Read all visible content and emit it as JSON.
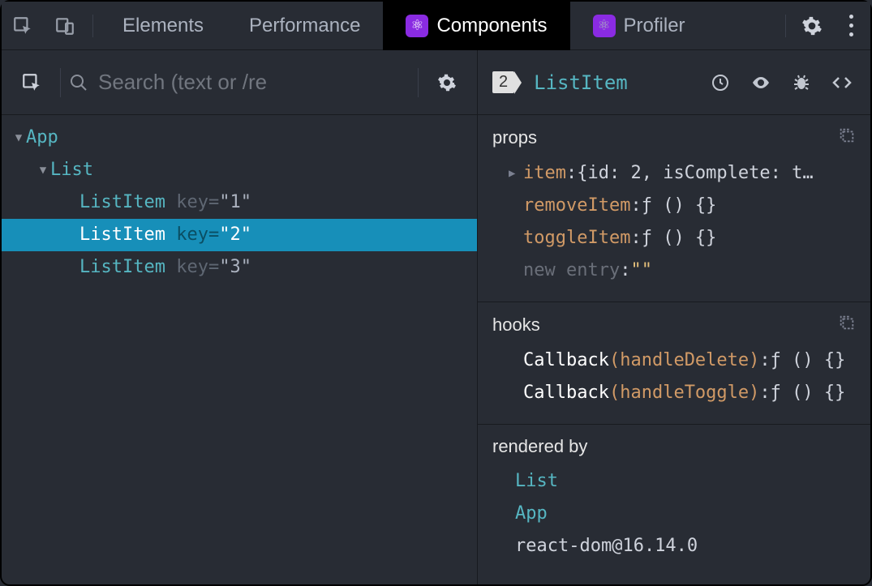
{
  "tabs": {
    "elements": "Elements",
    "performance": "Performance",
    "components": "Components",
    "profiler": "Profiler"
  },
  "search": {
    "placeholder": "Search (text or /re"
  },
  "tree": {
    "root": "App",
    "child": "List",
    "items": [
      {
        "name": "ListItem",
        "keyLabel": "key",
        "keyVal": "\"1\""
      },
      {
        "name": "ListItem",
        "keyLabel": "key",
        "keyVal": "\"2\""
      },
      {
        "name": "ListItem",
        "keyLabel": "key",
        "keyVal": "\"3\""
      }
    ]
  },
  "selected": {
    "badge": "2",
    "name": "ListItem"
  },
  "props": {
    "title": "props",
    "item": {
      "key": "item",
      "value": "{id: 2, isComplete: t…"
    },
    "removeItem": {
      "key": "removeItem",
      "value": "ƒ () {}"
    },
    "toggleItem": {
      "key": "toggleItem",
      "value": "ƒ () {}"
    },
    "newEntry": {
      "label": "new entry",
      "value": "\"\""
    }
  },
  "hooks": {
    "title": "hooks",
    "rows": [
      {
        "cb": "Callback",
        "name": "handleDelete",
        "value": "ƒ () {}"
      },
      {
        "cb": "Callback",
        "name": "handleToggle",
        "value": "ƒ () {}"
      }
    ]
  },
  "renderedBy": {
    "title": "rendered by",
    "chain": [
      "List",
      "App"
    ],
    "runtime": "react-dom@16.14.0"
  }
}
